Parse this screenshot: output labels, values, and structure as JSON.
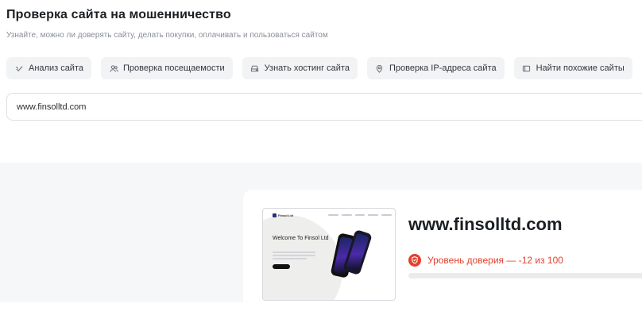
{
  "header": {
    "title": "Проверка сайта на мошенничество",
    "subtitle": "Узнайте, можно ли доверять сайту, делать покупки, оплачивать и пользоваться сайтом"
  },
  "tabs": [
    {
      "label": "Анализ сайта",
      "icon": "check-icon"
    },
    {
      "label": "Проверка посещаемости",
      "icon": "users-icon"
    },
    {
      "label": "Узнать хостинг сайта",
      "icon": "server-icon"
    },
    {
      "label": "Проверка IP-адреса сайта",
      "icon": "location-pin-icon"
    },
    {
      "label": "Найти похожие сайты",
      "icon": "window-icon"
    }
  ],
  "search": {
    "value": "www.finsolltd.com"
  },
  "result": {
    "domain": "www.finsolltd.com",
    "trust_text": "Уровень доверия — -12 из 100",
    "trust_score": -12,
    "trust_max": 100,
    "trust_color": "#e2412d",
    "trust_icon": "shield-alert-icon",
    "thumbnail": {
      "logo": "Finsol Ltd",
      "hero": "Welcome To Finsol Ltd"
    }
  }
}
